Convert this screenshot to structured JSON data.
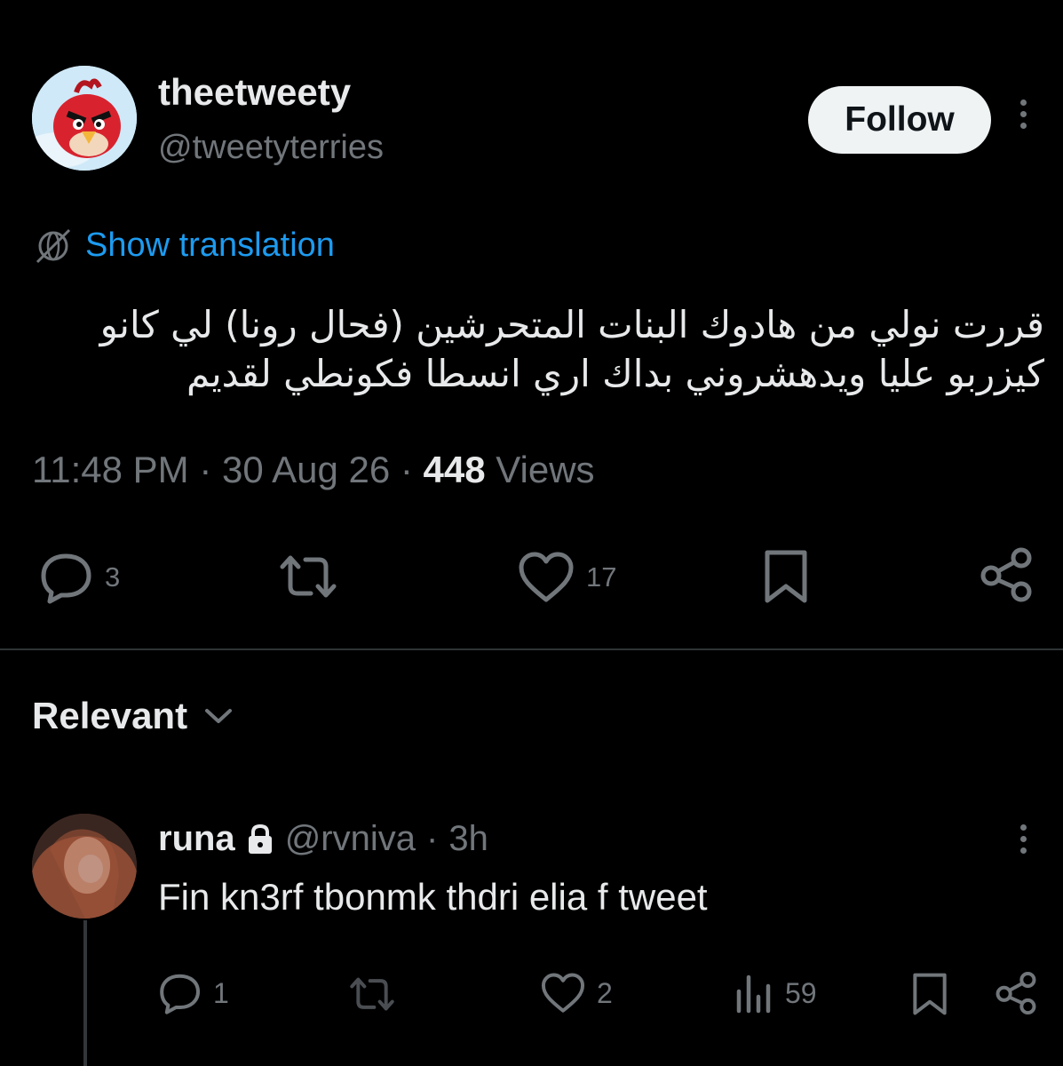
{
  "tweet": {
    "display_name": "theetweety",
    "handle": "@tweetyterries",
    "follow_label": "Follow",
    "translate_label": "Show translation",
    "text": "قررت نولي من هادوك البنات المتحرشين (فحال رونا) لي كانو كيزربو عليا ويدهشروني بداك اري انسطا فكونطي لقديم",
    "time": "11:48 PM",
    "date": "30 Aug 26",
    "separator": "·",
    "views_count": "448",
    "views_label": "Views",
    "actions": {
      "replies": "3",
      "reposts": "",
      "likes": "17"
    }
  },
  "sort": {
    "label": "Relevant"
  },
  "reply": {
    "display_name": "runa",
    "handle": "@rvniva",
    "separator": "·",
    "time": "3h",
    "text": "Fin kn3rf tbonmk thdri elia f tweet",
    "actions": {
      "replies": "1",
      "reposts": "",
      "likes": "2",
      "views": "59"
    }
  },
  "colors": {
    "background": "#000000",
    "text_primary": "#e7e9ea",
    "text_secondary": "#71767b",
    "accent": "#1d9bf0",
    "follow_bg": "#eff3f4"
  },
  "icons": [
    "translate-globe-icon",
    "reply-icon",
    "repost-icon",
    "like-icon",
    "bookmark-icon",
    "share-icon",
    "chevron-down-icon",
    "lock-icon",
    "views-icon",
    "more-icon"
  ]
}
